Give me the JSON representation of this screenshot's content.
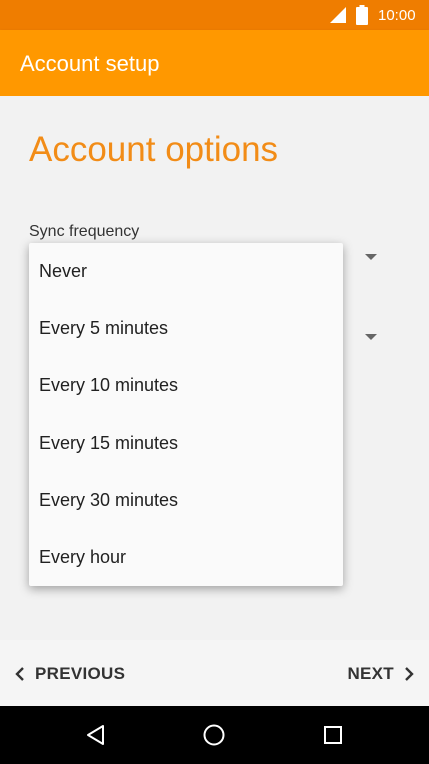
{
  "status_bar": {
    "time": "10:00",
    "icons": [
      "signal-icon",
      "battery-icon"
    ]
  },
  "app_bar": {
    "title": "Account setup"
  },
  "main": {
    "heading": "Account options",
    "sync_label": "Sync frequency"
  },
  "dropdown": {
    "options": [
      "Never",
      "Every 5 minutes",
      "Every 10 minutes",
      "Every 15 minutes",
      "Every 30 minutes",
      "Every hour"
    ]
  },
  "bottom_bar": {
    "previous_label": "PREVIOUS",
    "next_label": "NEXT"
  },
  "colors": {
    "status_bar": "#ef7d00",
    "app_bar": "#ff9800",
    "heading": "#f28c17"
  },
  "system_nav": {
    "icons": [
      "back-icon",
      "home-icon",
      "recent-apps-icon"
    ]
  }
}
